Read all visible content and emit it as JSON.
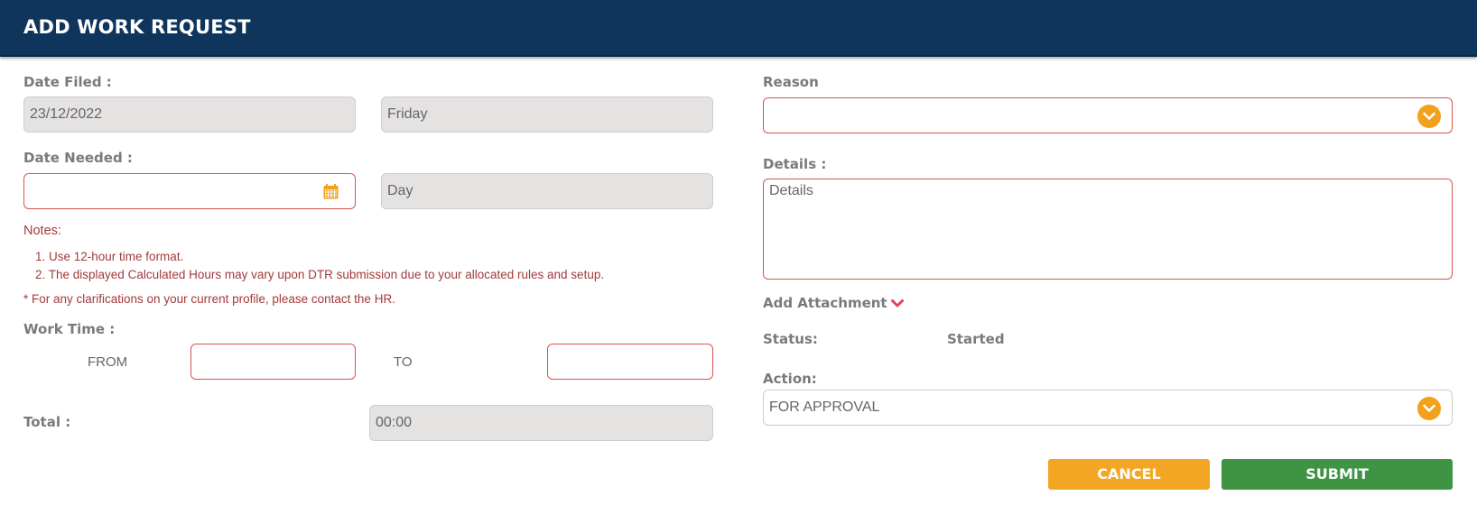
{
  "header": {
    "title": "ADD WORK REQUEST"
  },
  "left": {
    "date_filed_label": "Date Filed :",
    "date_filed_value": "23/12/2022",
    "date_filed_day": "Friday",
    "date_needed_label": "Date Needed :",
    "date_needed_value": "",
    "date_needed_day": "Day",
    "notes_title": "Notes:",
    "notes": [
      "1. Use 12-hour time format.",
      "2. The displayed Calculated Hours may vary upon DTR submission due to your allocated rules and setup."
    ],
    "clarification": "* For any clarifications on your current profile, please contact the HR.",
    "work_time_label": "Work Time :",
    "from_label": "FROM",
    "from_value": "",
    "to_label": "TO",
    "to_value": "",
    "total_label": "Total :",
    "total_value": "00:00"
  },
  "right": {
    "reason_label": "Reason",
    "reason_value": "",
    "details_label": "Details :",
    "details_placeholder": "Details",
    "attachment_label": "Add Attachment",
    "status_label": "Status:",
    "status_value": "Started",
    "action_label": "Action:",
    "action_value": "FOR APPROVAL"
  },
  "buttons": {
    "cancel": "CANCEL",
    "submit": "SUBMIT"
  },
  "colors": {
    "header_bg": "#0f355c",
    "required_border": "#d9534f",
    "dropdown_accent": "#f3a11c",
    "cancel_bg": "#f3a624",
    "submit_bg": "#3f9444",
    "notes_text": "#a33a3a"
  },
  "icons": {
    "calendar": "calendar-icon",
    "dropdown": "chevron-down-icon",
    "attachment_toggle": "chevron-down-icon"
  }
}
